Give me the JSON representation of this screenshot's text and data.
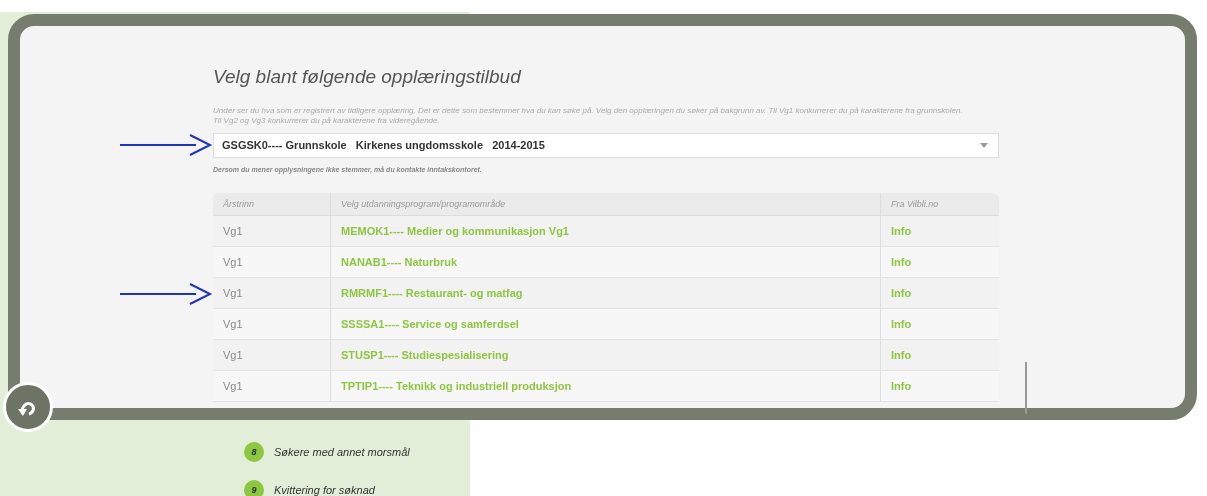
{
  "dialog": {
    "title": "Velg blant følgende opplæringstilbud",
    "description": "Under ser du hva som er registrert av tidligere opplæring. Det er dette som bestemmer hva du kan søke på. Velg den opplæringen du søker på bakgrunn av. Til Vg1 konkurrerer du på karakterene fra grunnskolen. Til Vg2 og Vg3 konkurrerer du på karakterene fra videregående.",
    "select": {
      "value": "GSGSK0---- Grunnskole   Kirkenes ungdomsskole   2014-2015"
    },
    "note": "Dersom du mener opplysningene ikke stemmer, må du kontakte inntakskontoret.",
    "table": {
      "columns": [
        "Årstrinn",
        "Velg utdanningsprogram/programområde",
        "Fra Vilbli.no"
      ],
      "rows": [
        {
          "level": "Vg1",
          "program": "MEMOK1---- Medier og kommunikasjon Vg1",
          "link": "Info",
          "annotated": false
        },
        {
          "level": "Vg1",
          "program": "NANAB1---- Naturbruk",
          "link": "Info",
          "annotated": false
        },
        {
          "level": "Vg1",
          "program": "RMRMF1---- Restaurant- og matfag",
          "link": "Info",
          "annotated": true
        },
        {
          "level": "Vg1",
          "program": "SSSSA1---- Service og samferdsel",
          "link": "Info",
          "annotated": false
        },
        {
          "level": "Vg1",
          "program": "STUSP1---- Studiespesialisering",
          "link": "Info",
          "annotated": false
        },
        {
          "level": "Vg1",
          "program": "TPTIP1---- Teknikk og industriell produksjon",
          "link": "Info",
          "annotated": false
        }
      ]
    }
  },
  "steps": [
    {
      "number": "8",
      "label": "Søkere med annet morsmål"
    },
    {
      "number": "9",
      "label": "Kvittering for søknad"
    }
  ]
}
